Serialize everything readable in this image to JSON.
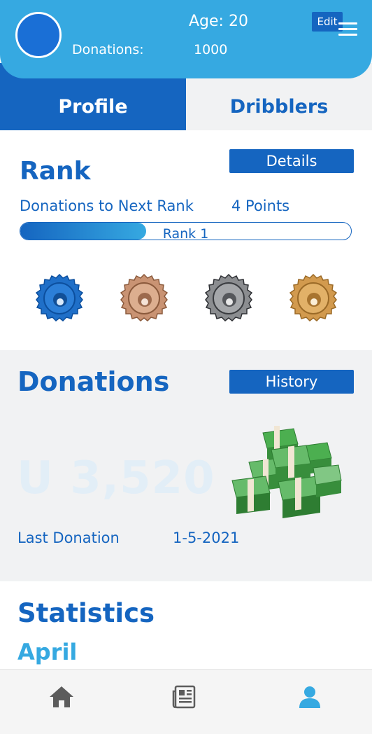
{
  "header": {
    "age": "Age: 20",
    "donations_label": "Donations:",
    "donations_value": "1000",
    "edit_label": "Edit",
    "avatar_color": "#1a6fd6",
    "background_color": "#36a9e1"
  },
  "tabs": [
    {
      "label": "Profile",
      "active": true
    },
    {
      "label": "Dribblers",
      "active": false
    }
  ],
  "rank": {
    "title": "Rank",
    "details_label": "Details",
    "next_rank_label": "Donations to Next Rank",
    "next_rank_value": "4 Points",
    "progress_label": "Rank 1",
    "progress_fraction": 0.38,
    "badges": [
      {
        "name": "blue-rank-badge-icon",
        "color": "#1f6fc8"
      },
      {
        "name": "bronze-rank-badge-icon",
        "color": "#c99373"
      },
      {
        "name": "silver-rank-badge-icon",
        "color": "#8b8d90"
      },
      {
        "name": "gold-rank-badge-icon",
        "color": "#d29a4e"
      }
    ]
  },
  "donations": {
    "title": "Donations",
    "history_label": "History",
    "amount_text": "U  3,520",
    "last_donation_label": "Last Donation",
    "last_donation_value": "1-5-2021",
    "money_icon": "money-stack-icon"
  },
  "statistics": {
    "title": "Statistics",
    "month": "April"
  },
  "bottom_nav": [
    {
      "icon": "home-icon"
    },
    {
      "icon": "newspaper-icon"
    },
    {
      "icon": "user-icon",
      "active": true
    }
  ],
  "colors": {
    "primary": "#1565c0",
    "accent": "#36a9e1",
    "section_bg": "#f1f2f3"
  }
}
